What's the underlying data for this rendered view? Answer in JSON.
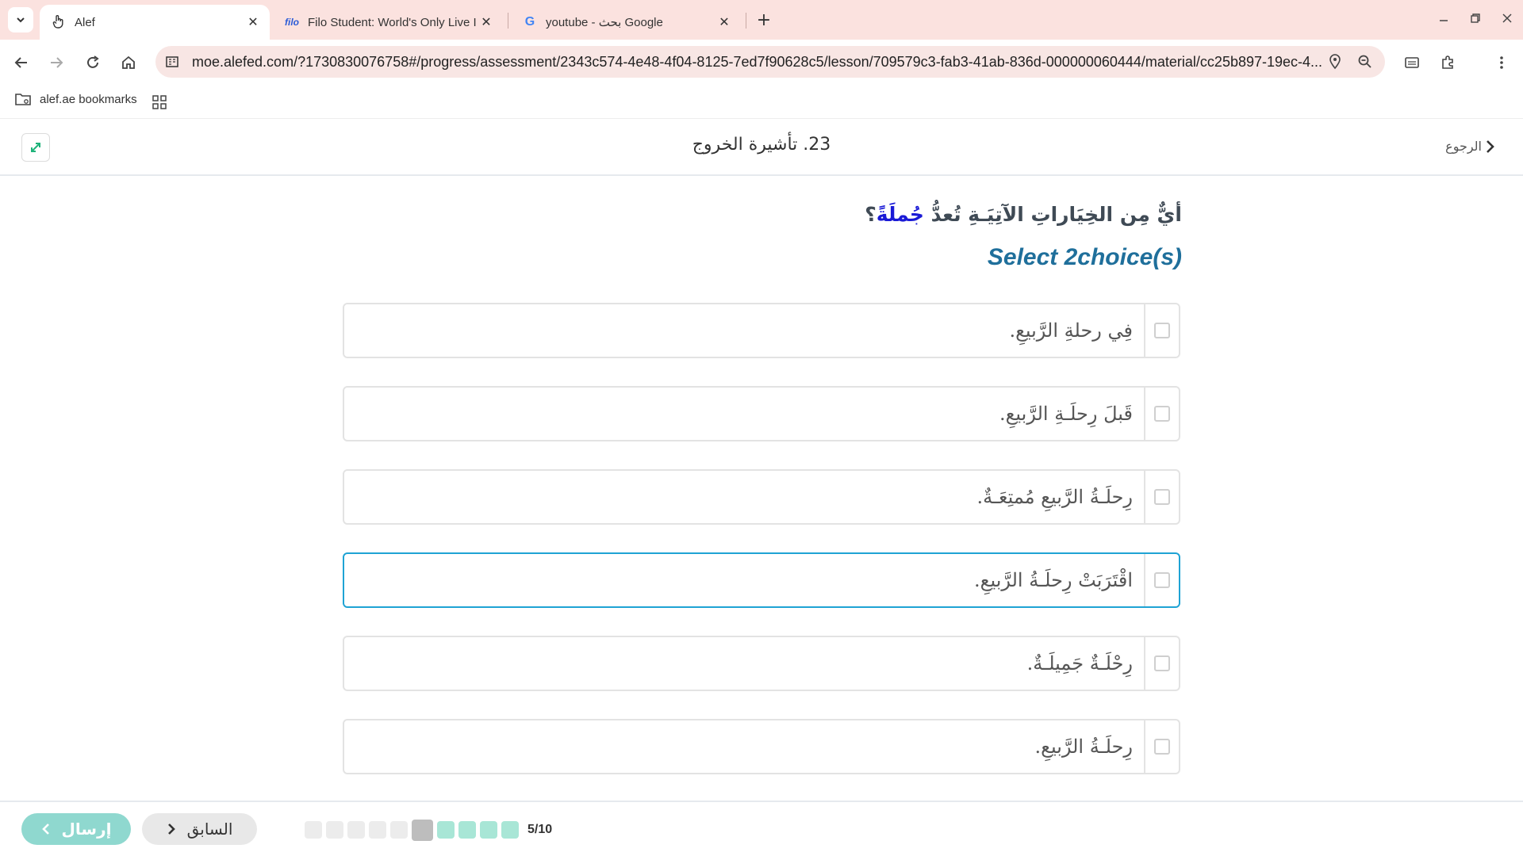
{
  "browser": {
    "tabs": [
      {
        "title": "Alef",
        "favicon": "hand-icon",
        "active": true
      },
      {
        "title": "Filo Student: World's Only Live I",
        "favicon_text": "filo",
        "active": false
      },
      {
        "title": "youtube - بحث Google",
        "favicon_text": "G",
        "active": false
      }
    ],
    "url": "moe.alefed.com/?1730830076758#/progress/assessment/2343c574-4e48-4f04-8125-7ed7f90628c5/lesson/709579c3-fab3-41ab-836d-000000060444/material/cc25b897-19ec-4...",
    "bookmarks": [
      {
        "label": "alef.ae bookmarks"
      }
    ]
  },
  "header": {
    "title": "23. تأشيرة الخروج",
    "back_label": "الرجوع"
  },
  "question": {
    "text_before": "أيٌّ مِن الخِيَاراتِ الآتِيَـةِ تُعدُّ ",
    "highlight": "جُملَةً",
    "text_after": "؟",
    "instruction": "Select 2choice(s)"
  },
  "options": [
    {
      "text": "فِي رحلةِ الرَّبيعِ.",
      "checked": false
    },
    {
      "text": "قَبلَ رِحلَـةِ الرَّبيعِ.",
      "checked": false
    },
    {
      "text": "رِحلَـةُ الرَّبيعِ مُمتِعَـةٌ.",
      "checked": false
    },
    {
      "text": "اقْتَرَبَتْ رِحلَـةُ الرَّبيعِ.",
      "checked": false,
      "focused": true
    },
    {
      "text": "رِحْلَـةٌ جَمِيلَـةٌ.",
      "checked": false
    },
    {
      "text": "رِحلَـةُ الرَّبيعِ.",
      "checked": false
    }
  ],
  "footer": {
    "submit_label": "إرسال",
    "prev_label": "السابق",
    "progress_text": "5/10",
    "progress_states": [
      "pending",
      "pending",
      "pending",
      "pending",
      "pending",
      "current",
      "done",
      "done",
      "done",
      "done"
    ]
  },
  "colors": {
    "tabbar_bg": "#fbe2df",
    "accent_teal": "#8fd8cf",
    "question_highlight": "#1a1ad6",
    "instruction": "#1f6f9b",
    "focus_border": "#1fa3d4"
  }
}
